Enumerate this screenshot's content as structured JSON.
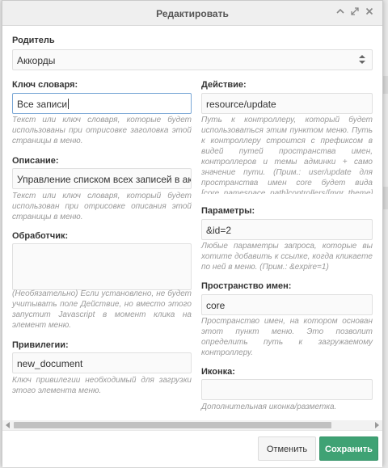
{
  "window": {
    "title": "Редактировать",
    "tools": [
      "collapse-icon",
      "expand-icon",
      "close-icon"
    ]
  },
  "parent": {
    "label": "Родитель",
    "value": "Аккорды"
  },
  "dict_key": {
    "label": "Ключ словаря:",
    "value": "Все записи",
    "desc": "Текст или ключ словаря, которые будет использованы при отрисовке заголовка этой страницы в меню."
  },
  "description": {
    "label": "Описание:",
    "value": "Управление списком всех записей в аккорда",
    "desc": "Текст или ключ словаря, который будет использован при отрисовке описания этой страницы в меню."
  },
  "handler": {
    "label": "Обработчик:",
    "value": "",
    "desc": "(Необязательно) Если установлено, не будет учитывать поле Действие, но вместо этого запустит Javascript в момент клика на элемент меню."
  },
  "privileges": {
    "label": "Привилегии:",
    "value": "new_document",
    "desc": "Ключ привилегии необходимый для загрузки этого элемента меню."
  },
  "action": {
    "label": "Действие:",
    "value": "resource/update",
    "desc": "Путь к контроллеру, который будет использоваться этим пунктом меню. Путь к контроллеру строится с префиксом в видей путей пространства имен, контроллеров и темы админки + само значение пути. (Прим.: user/update для пространства имен core будет вида [core_namespace_path]controllers/[mgr_theme]/user"
  },
  "params": {
    "label": "Параметры:",
    "value": "&id=2",
    "desc": "Любые параметры запроса, которые вы хотите добавить к ссылке, когда кликаете по ней в меню. (Прим.: &expire=1)"
  },
  "namespace": {
    "label": "Пространство имен:",
    "value": "core",
    "desc": "Пространство имен, на котором основан этот пункт меню. Это позволит определить путь к загружаемому контроллеру."
  },
  "icon": {
    "label": "Иконка:",
    "value": "",
    "desc": "Дополнительная иконка/разметка."
  },
  "buttons": {
    "cancel": "Отменить",
    "save": "Сохранить"
  },
  "colors": {
    "save": "#3fa274",
    "focus_border": "#7aa7d6"
  }
}
